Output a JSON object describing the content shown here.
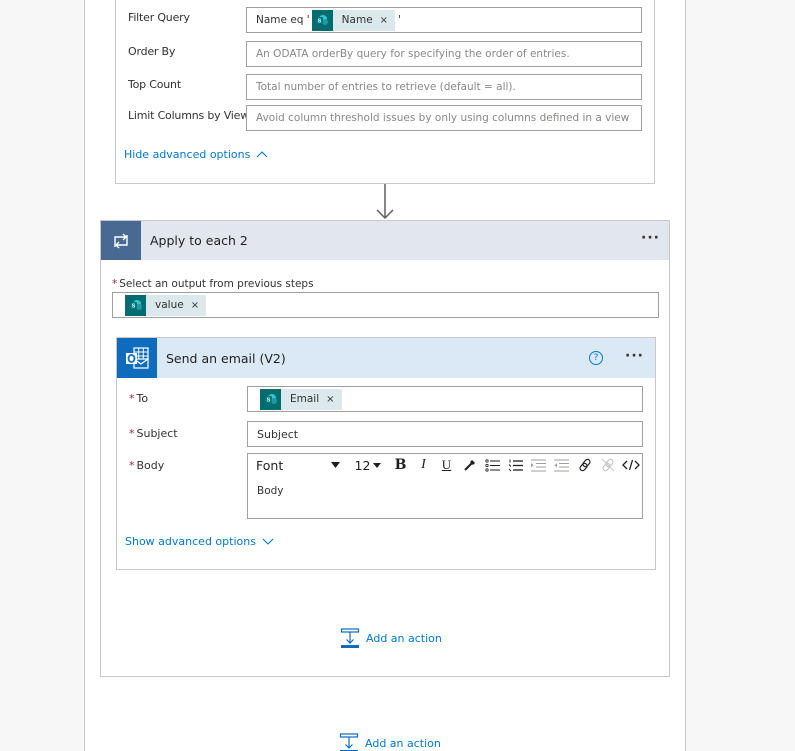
{
  "get_items": {
    "fields": [
      {
        "label": "Filter Query",
        "value_prefix": "Name eq '",
        "token": "Name",
        "value_suffix": "'"
      },
      {
        "label": "Order By",
        "placeholder": "An ODATA orderBy query for specifying the order of entries."
      },
      {
        "label": "Top Count",
        "placeholder": "Total number of entries to retrieve (default = all)."
      },
      {
        "label": "Limit Columns by View",
        "placeholder": "Avoid column threshold issues by only using columns defined in a view"
      }
    ],
    "advanced_toggle": "Hide advanced options"
  },
  "apply_each": {
    "title": "Apply to each 2",
    "menu": "···",
    "select_label": "Select an output from previous steps",
    "required_mark": "*",
    "token": "value"
  },
  "send_email": {
    "title": "Send an email (V2)",
    "help": "?",
    "menu": "···",
    "to_label": "To",
    "to_token": "Email",
    "subject_label": "Subject",
    "subject_value": "Subject",
    "body_label": "Body",
    "body_value": "Body",
    "toolbar": {
      "font": "Font",
      "size": "12",
      "bold": "B",
      "italic": "I",
      "underline": "U"
    },
    "advanced_toggle": "Show advanced options"
  },
  "add_action_inner": "Add an action",
  "add_action_outer": "Add an action",
  "token_close": "×",
  "colors": {
    "accent": "#0078d4",
    "sharepoint": "#036c70",
    "apply_header": "#486991",
    "outlook": "#0f6cbd",
    "required": "#a4262c"
  }
}
